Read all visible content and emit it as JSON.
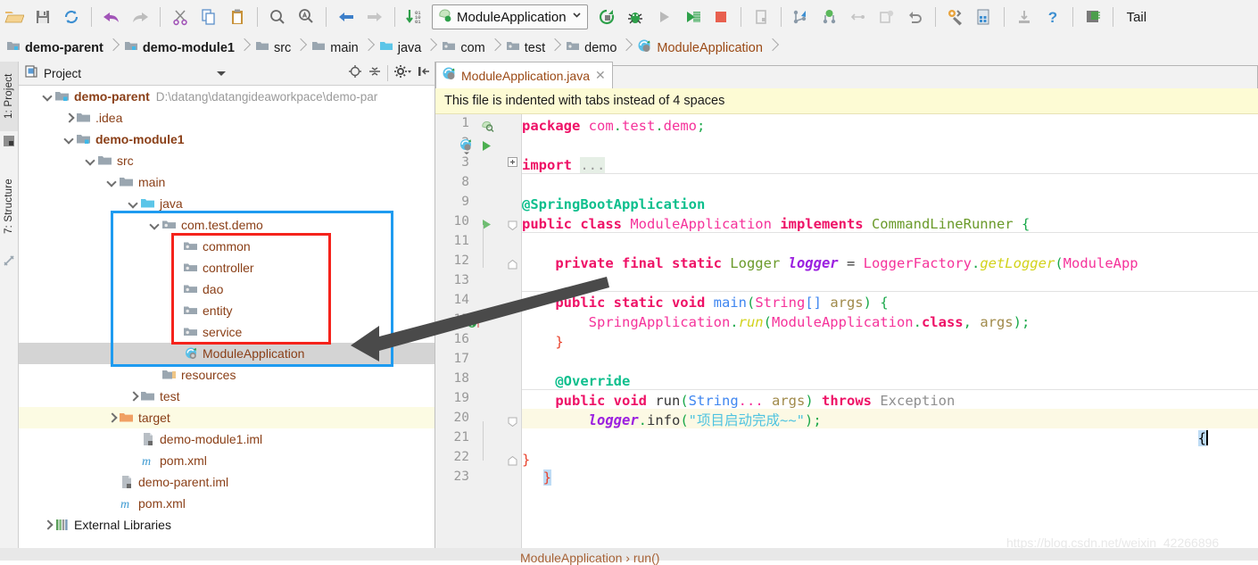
{
  "toolbar": {
    "icons": [
      "open-folder-icon",
      "save-all-icon",
      "sync-icon",
      "undo-icon",
      "redo-icon",
      "cut-icon",
      "copy-icon",
      "paste-icon",
      "find-icon",
      "replace-icon",
      "back-icon",
      "forward-icon",
      "compile-icon"
    ],
    "run_config": {
      "name": "ModuleApplication",
      "icon": "spring-boot-run-config-icon",
      "dropdown": "chevron-down-icon"
    },
    "run_icons": [
      "rerun-icon",
      "debug-icon",
      "run-icon",
      "run-coverage-icon",
      "stop-icon",
      "attach-profiler-icon"
    ],
    "vcs_icons": [
      "vcs-update-icon",
      "vcs-commit-icon",
      "vcs-push-icon",
      "vcs-shelve-icon",
      "vcs-rollback-icon"
    ],
    "settings_icons": [
      "settings-icon",
      "project-structure-icon",
      "sdk-icon"
    ],
    "help_icon": "help-icon",
    "extra_icon": "save-chip-icon",
    "tail_label": "Tail"
  },
  "breadcrumb": {
    "items": [
      {
        "label": "demo-parent",
        "icon": "module-icon",
        "bold": true,
        "type": "module"
      },
      {
        "label": "demo-module1",
        "icon": "module-icon",
        "bold": true,
        "type": "module"
      },
      {
        "label": "src",
        "icon": "folder-icon",
        "bold": false,
        "type": "folder"
      },
      {
        "label": "main",
        "icon": "folder-icon",
        "bold": false,
        "type": "folder"
      },
      {
        "label": "java",
        "icon": "source-folder-icon",
        "bold": false,
        "type": "source"
      },
      {
        "label": "com",
        "icon": "package-icon",
        "bold": false,
        "type": "package"
      },
      {
        "label": "test",
        "icon": "package-icon",
        "bold": false,
        "type": "package"
      },
      {
        "label": "demo",
        "icon": "package-icon",
        "bold": false,
        "type": "package"
      },
      {
        "label": "ModuleApplication",
        "icon": "spring-class-icon",
        "bold": false,
        "type": "class"
      }
    ]
  },
  "left_strip": {
    "tabs": [
      {
        "label": "1: Project",
        "selected": true,
        "name": "tool-window-project"
      },
      {
        "label": "7: Structure",
        "selected": false,
        "name": "tool-window-structure"
      }
    ]
  },
  "project_panel": {
    "title": "Project",
    "tool_icons": [
      "locate-icon",
      "collapse-all-icon",
      "settings-gear-icon",
      "hide-icon"
    ],
    "tree": [
      {
        "label": "demo-parent",
        "path": "D:\\datang\\datangideaworkpace\\demo-par",
        "depth": 0,
        "arrow": "down",
        "icon": "module-icon",
        "bold": true,
        "state": "none"
      },
      {
        "label": ".idea",
        "path": "",
        "depth": 1,
        "arrow": "right",
        "icon": "folder-icon",
        "bold": false,
        "state": "none"
      },
      {
        "label": "demo-module1",
        "path": "",
        "depth": 1,
        "arrow": "down",
        "icon": "module-icon",
        "bold": true,
        "state": "none"
      },
      {
        "label": "src",
        "path": "",
        "depth": 2,
        "arrow": "down",
        "icon": "folder-icon",
        "bold": false,
        "state": "none"
      },
      {
        "label": "main",
        "path": "",
        "depth": 3,
        "arrow": "down",
        "icon": "folder-icon",
        "bold": false,
        "state": "none"
      },
      {
        "label": "java",
        "path": "",
        "depth": 4,
        "arrow": "down",
        "icon": "source-folder-icon",
        "bold": false,
        "state": "none"
      },
      {
        "label": "com.test.demo",
        "path": "",
        "depth": 5,
        "arrow": "down",
        "icon": "package-icon",
        "bold": false,
        "state": "none"
      },
      {
        "label": "common",
        "path": "",
        "depth": 6,
        "arrow": "none",
        "icon": "package-icon",
        "bold": false,
        "state": "none"
      },
      {
        "label": "controller",
        "path": "",
        "depth": 6,
        "arrow": "none",
        "icon": "package-icon",
        "bold": false,
        "state": "none"
      },
      {
        "label": "dao",
        "path": "",
        "depth": 6,
        "arrow": "none",
        "icon": "package-icon",
        "bold": false,
        "state": "none"
      },
      {
        "label": "entity",
        "path": "",
        "depth": 6,
        "arrow": "none",
        "icon": "package-icon",
        "bold": false,
        "state": "none"
      },
      {
        "label": "service",
        "path": "",
        "depth": 6,
        "arrow": "none",
        "icon": "package-icon",
        "bold": false,
        "state": "none"
      },
      {
        "label": "ModuleApplication",
        "path": "",
        "depth": 6,
        "arrow": "none",
        "icon": "spring-class-icon",
        "bold": false,
        "state": "selected"
      },
      {
        "label": "resources",
        "path": "",
        "depth": 5,
        "arrow": "none",
        "icon": "resources-folder-icon",
        "bold": false,
        "state": "none"
      },
      {
        "label": "test",
        "path": "",
        "depth": 4,
        "arrow": "right",
        "icon": "folder-icon",
        "bold": false,
        "state": "none"
      },
      {
        "label": "target",
        "path": "",
        "depth": 3,
        "arrow": "right",
        "icon": "target-folder-icon",
        "bold": false,
        "state": "highlight"
      },
      {
        "label": "demo-module1.iml",
        "path": "",
        "depth": 4,
        "arrow": "none",
        "icon": "iml-file-icon",
        "bold": false,
        "state": "none"
      },
      {
        "label": "pom.xml",
        "path": "",
        "depth": 4,
        "arrow": "none",
        "icon": "maven-icon",
        "bold": false,
        "state": "none"
      },
      {
        "label": "demo-parent.iml",
        "path": "",
        "depth": 3,
        "arrow": "none",
        "icon": "iml-file-icon",
        "bold": false,
        "state": "none"
      },
      {
        "label": "pom.xml",
        "path": "",
        "depth": 3,
        "arrow": "none",
        "icon": "maven-icon",
        "bold": false,
        "state": "none"
      },
      {
        "label": "External Libraries",
        "path": "",
        "depth": 0,
        "arrow": "right",
        "icon": "libraries-icon",
        "bold": false,
        "state": "dark"
      }
    ]
  },
  "editor": {
    "tab": {
      "label": "ModuleApplication.java",
      "icon": "spring-class-icon",
      "close": "close-icon"
    },
    "banner": "This file is indented with tabs instead of 4 spaces",
    "line_numbers": [
      "1",
      "2",
      "3",
      "8",
      "9",
      "10",
      "11",
      "12",
      "13",
      "14",
      "15",
      "16",
      "17",
      "18",
      "19",
      "20",
      "21",
      "22",
      "23"
    ],
    "gutter_icons": [
      "bean-icon",
      "run-gutter-icon",
      "run-class-gutter-icon",
      "run-method-gutter-icon",
      "override-method-icon"
    ],
    "code": [
      {
        "n": "1",
        "tokens": [
          {
            "t": "package ",
            "c": "kw"
          },
          {
            "t": "com",
            "c": "pkg"
          },
          {
            "t": ".",
            "c": "punc"
          },
          {
            "t": "test",
            "c": "pkg"
          },
          {
            "t": ".",
            "c": "punc"
          },
          {
            "t": "demo",
            "c": "pkg"
          },
          {
            "t": ";",
            "c": "punc"
          }
        ]
      },
      {
        "n": "2",
        "tokens": []
      },
      {
        "n": "3",
        "tokens": [
          {
            "t": "import ",
            "c": "kw"
          },
          {
            "t": "...",
            "c": "dots"
          }
        ]
      },
      {
        "n": "8",
        "tokens": []
      },
      {
        "n": "9",
        "tokens": [
          {
            "t": "@SpringBootApplication",
            "c": "anno"
          }
        ]
      },
      {
        "n": "10",
        "tokens": [
          {
            "t": "public class ",
            "c": "kw"
          },
          {
            "t": "ModuleApplication",
            "c": "cls2"
          },
          {
            "t": " ",
            "c": "ident"
          },
          {
            "t": "implements ",
            "c": "kw"
          },
          {
            "t": "CommandLineRunner",
            "c": "type"
          },
          {
            "t": " {",
            "c": "punc"
          }
        ]
      },
      {
        "n": "11",
        "tokens": []
      },
      {
        "n": "12",
        "tokens": [
          {
            "t": "    private final static ",
            "c": "kw"
          },
          {
            "t": "Logger",
            "c": "type"
          },
          {
            "t": " ",
            "c": "ident"
          },
          {
            "t": "logger",
            "c": "fld"
          },
          {
            "t": " = ",
            "c": "ident"
          },
          {
            "t": "LoggerFactory",
            "c": "cls2"
          },
          {
            "t": ".",
            "c": "punc"
          },
          {
            "t": "getLogger",
            "c": "mth"
          },
          {
            "t": "(",
            "c": "punc"
          },
          {
            "t": "ModuleApp",
            "c": "cls2"
          }
        ]
      },
      {
        "n": "13",
        "tokens": []
      },
      {
        "n": "14",
        "tokens": [
          {
            "t": "    public static void ",
            "c": "kw"
          },
          {
            "t": "main",
            "c": "blue2"
          },
          {
            "t": "(",
            "c": "punc"
          },
          {
            "t": "String",
            "c": "cls2"
          },
          {
            "t": "[]",
            "c": "blue2"
          },
          {
            "t": " args",
            "c": "param"
          },
          {
            "t": ")",
            "c": "punc"
          },
          {
            "t": " {",
            "c": "punc"
          }
        ]
      },
      {
        "n": "15",
        "tokens": [
          {
            "t": "        ",
            "c": "ident"
          },
          {
            "t": "SpringApplication",
            "c": "cls2"
          },
          {
            "t": ".",
            "c": "punc"
          },
          {
            "t": "run",
            "c": "mth"
          },
          {
            "t": "(",
            "c": "punc"
          },
          {
            "t": "ModuleApplication",
            "c": "cls2"
          },
          {
            "t": ".",
            "c": "punc"
          },
          {
            "t": "class",
            "c": "kw"
          },
          {
            "t": ", ",
            "c": "punc"
          },
          {
            "t": "args",
            "c": "param"
          },
          {
            "t": ")",
            "c": "punc"
          },
          {
            "t": ";",
            "c": "punc"
          }
        ]
      },
      {
        "n": "16",
        "tokens": [
          {
            "t": "    }",
            "c": "red2"
          }
        ]
      },
      {
        "n": "17",
        "tokens": []
      },
      {
        "n": "18",
        "tokens": [
          {
            "t": "    @Override",
            "c": "anno"
          }
        ]
      },
      {
        "n": "19",
        "tokens": [
          {
            "t": "    public void ",
            "c": "kw"
          },
          {
            "t": "run",
            "c": "ident"
          },
          {
            "t": "(",
            "c": "punc"
          },
          {
            "t": "String",
            "c": "blue2"
          },
          {
            "t": "...",
            "c": "cls2"
          },
          {
            "t": " args",
            "c": "param"
          },
          {
            "t": ")",
            "c": "punc"
          },
          {
            "t": " ",
            "c": "ident"
          },
          {
            "t": "throws ",
            "c": "kw"
          },
          {
            "t": "Exception",
            "c": "gray2"
          },
          {
            "t": " ",
            "c": "ident"
          }
        ]
      },
      {
        "n": "20",
        "tokens": [
          {
            "t": "        ",
            "c": "ident"
          },
          {
            "t": "logger",
            "c": "fld"
          },
          {
            "t": ".",
            "c": "punc"
          },
          {
            "t": "info",
            "c": "ident"
          },
          {
            "t": "(",
            "c": "punc"
          },
          {
            "t": "\"项目启动完成~~\"",
            "c": "str"
          },
          {
            "t": ")",
            "c": "punc"
          },
          {
            "t": ";",
            "c": "punc"
          }
        ]
      },
      {
        "n": "21",
        "tokens": []
      },
      {
        "n": "22",
        "tokens": [
          {
            "t": "}",
            "c": "red2"
          }
        ]
      },
      {
        "n": "23",
        "tokens": []
      }
    ],
    "line19_tail": "{",
    "line21_brace": "}",
    "status_breadcrumb": "ModuleApplication  ›  run()"
  },
  "annotations": {
    "blue_box_name": "blue-highlight-box",
    "red_box_name": "red-highlight-box",
    "arrow_name": "annotation-arrow"
  },
  "watermark": "https://blog.csdn.net/weixin_42266896",
  "colors": {
    "accent_blue": "#1e9bf0",
    "accent_red": "#f5231c",
    "selection_gray": "#d4d4d4",
    "banner_yellow": "#fdfbd4",
    "tree_text": "#8a3f17"
  }
}
